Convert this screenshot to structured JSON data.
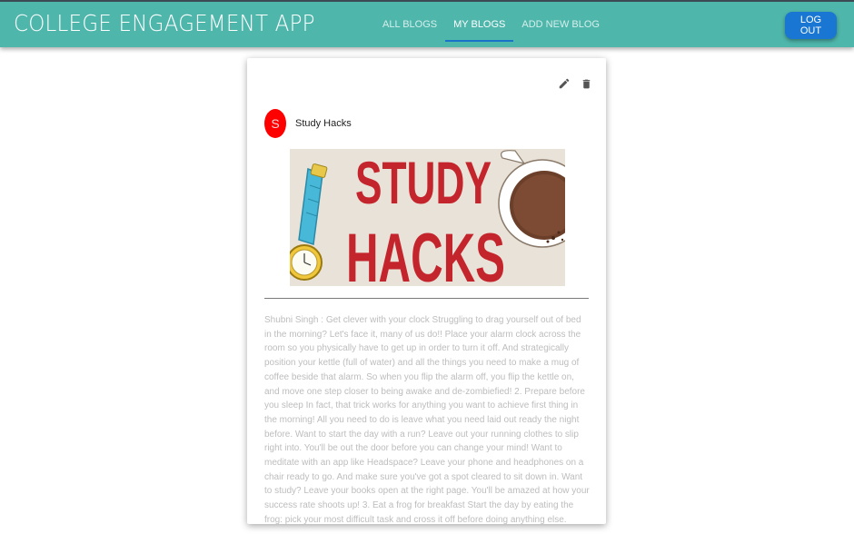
{
  "header": {
    "title": "COLLEGE ENGAGEMENT APP",
    "tabs": [
      {
        "label": "ALL BLOGS",
        "active": false
      },
      {
        "label": "MY BLOGS",
        "active": true
      },
      {
        "label": "ADD NEW BLOG",
        "active": false
      }
    ],
    "logout_label": "LOG OUT",
    "colors": {
      "bar": "#4fb6ab",
      "accent": "#1976d2"
    }
  },
  "post": {
    "avatar_letter": "S",
    "avatar_color": "#ff0000",
    "title": "Study Hacks",
    "edit_icon": "pencil-icon",
    "delete_icon": "trash-icon",
    "image": {
      "word_1": "STUDY",
      "word_2": "HACKS"
    },
    "body": "Shubni Singh : Get clever with your clock Struggling to drag yourself out of bed in the morning? Let's face it, many of us do!! Place your alarm clock across the room so you physically have to get up in order to turn it off. And strategically position your kettle (full of water) and all the things you need to make a mug of coffee beside that alarm. So when you flip the alarm off, you flip the kettle on, and move one step closer to being awake and de-zombiefied! 2. Prepare before you sleep In fact, that trick works for anything you want to achieve first thing in the morning! All you need to do is leave what you need laid out ready the night before. Want to start the day with a run? Leave out your running clothes to slip right into. You'll be out the door before you can change your mind! Want to meditate with an app like Headspace? Leave your phone and headphones on a chair ready to go. And make sure you've got a spot cleared to sit down in. Want to study? Leave your books open at the right page. You'll be amazed at how your success rate shoots up! 3. Eat a frog for breakfast Start the day by eating the frog: pick your most difficult task and cross it off before doing anything else."
  }
}
